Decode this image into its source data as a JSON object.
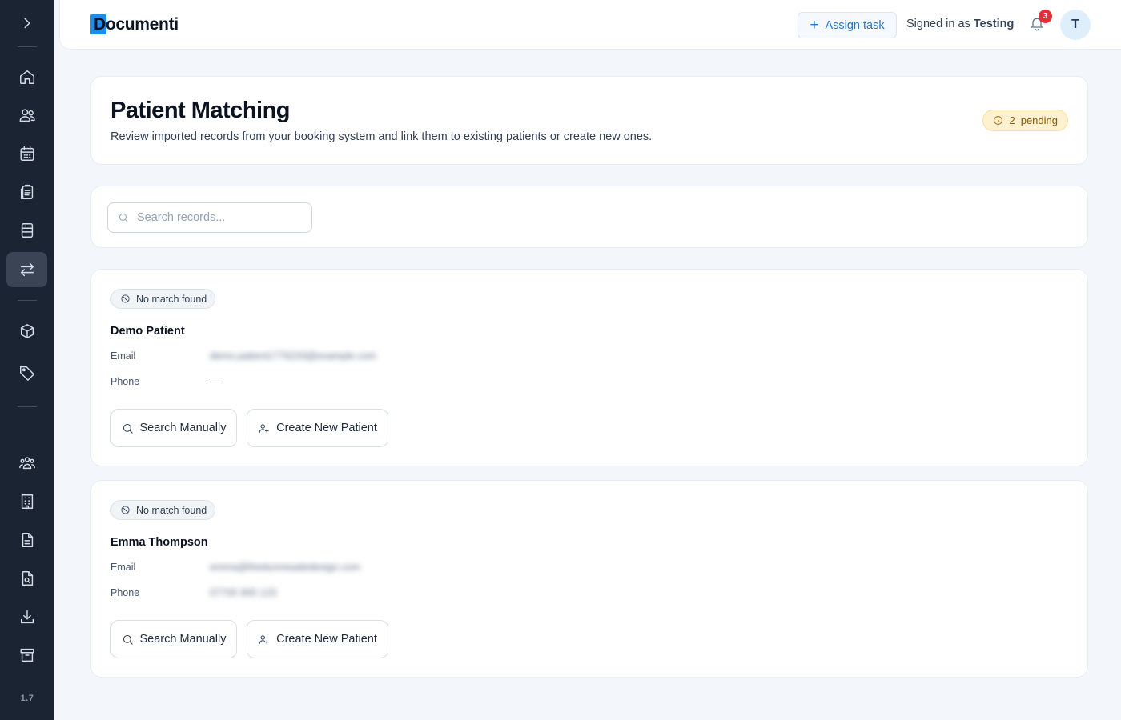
{
  "app": {
    "logo_text": "Documenti",
    "version": "1.7"
  },
  "sidebar": {
    "items": [
      {
        "icon": "chevron-right-icon"
      },
      {
        "icon": "home-icon"
      },
      {
        "icon": "users-icon"
      },
      {
        "icon": "calendar-icon"
      },
      {
        "icon": "clipboard-icon"
      },
      {
        "icon": "form-icon"
      },
      {
        "icon": "transfer-icon",
        "active": true
      },
      {
        "icon": "box-icon"
      },
      {
        "icon": "tag-icon"
      },
      {
        "icon": "team-icon"
      },
      {
        "icon": "building-icon"
      },
      {
        "icon": "document-icon"
      },
      {
        "icon": "document-search-icon"
      },
      {
        "icon": "download-icon"
      },
      {
        "icon": "archive-icon"
      }
    ]
  },
  "header": {
    "assign_task": "Assign task",
    "signed_in_prefix": "Signed in as",
    "user_name": "Testing",
    "notification_count": "3",
    "avatar_initial": "T"
  },
  "page": {
    "title": "Patient Matching",
    "subtitle": "Review imported records from your booking system and link them to existing patients or create new ones.",
    "pending_count": "2",
    "pending_label": "pending"
  },
  "search": {
    "placeholder": "Search records..."
  },
  "records": [
    {
      "status": "No match found",
      "name": "Demo Patient",
      "email_label": "Email",
      "email_value": "demo.patient1776233@example.com",
      "phone_label": "Phone",
      "phone_value": "—",
      "search_btn": "Search Manually",
      "create_btn": "Create New Patient"
    },
    {
      "status": "No match found",
      "name": "Emma Thompson",
      "email_label": "Email",
      "email_value": "emma@thedunmeadedesign.com",
      "phone_label": "Phone",
      "phone_value": "07700 900 123",
      "search_btn": "Search Manually",
      "create_btn": "Create New Patient"
    }
  ],
  "colors": {
    "sidebar_bg": "#1b2432",
    "accent": "#2c74c4",
    "logo_blue": "#1d8cf0",
    "badge_red": "#e5303b",
    "pending_bg": "#fdf1cf"
  }
}
